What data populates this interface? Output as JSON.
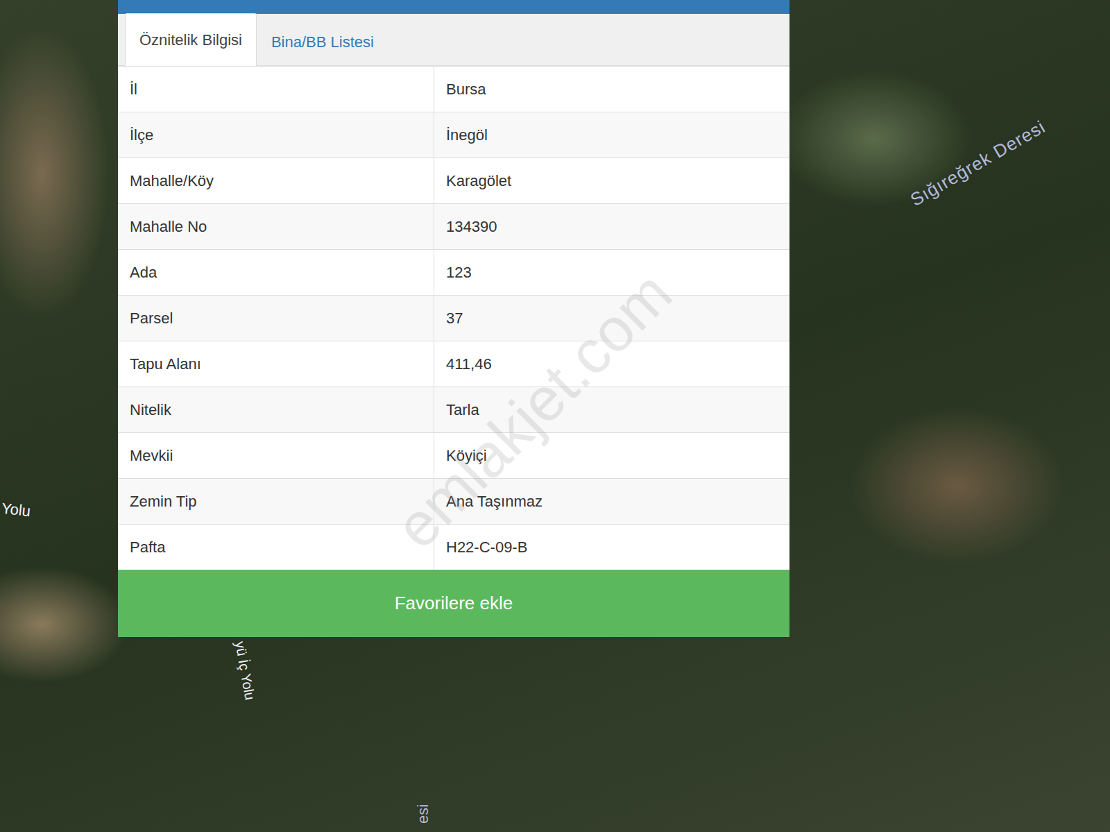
{
  "map": {
    "labels": [
      {
        "text": "Sığıreğrek Deresi"
      },
      {
        "text": "Yolu"
      },
      {
        "text": "yü İç Yolu"
      },
      {
        "text": "esi"
      }
    ],
    "watermark": "emlakjet.com"
  },
  "panel": {
    "tabs": [
      {
        "label": "Öznitelik Bilgisi",
        "selected": true
      },
      {
        "label": "Bina/BB Listesi",
        "selected": false
      }
    ],
    "rows": [
      {
        "label": "İl",
        "value": "Bursa"
      },
      {
        "label": "İlçe",
        "value": "İnegöl"
      },
      {
        "label": "Mahalle/Köy",
        "value": "Karagölet"
      },
      {
        "label": "Mahalle No",
        "value": "134390"
      },
      {
        "label": "Ada",
        "value": "123"
      },
      {
        "label": "Parsel",
        "value": "37"
      },
      {
        "label": "Tapu Alanı",
        "value": "411,46"
      },
      {
        "label": "Nitelik",
        "value": "Tarla"
      },
      {
        "label": "Mevkii",
        "value": "Köyiçi"
      },
      {
        "label": "Zemin Tip",
        "value": "Ana Taşınmaz"
      },
      {
        "label": "Pafta",
        "value": "H22-C-09-B"
      }
    ],
    "button": "Favorilere ekle"
  }
}
